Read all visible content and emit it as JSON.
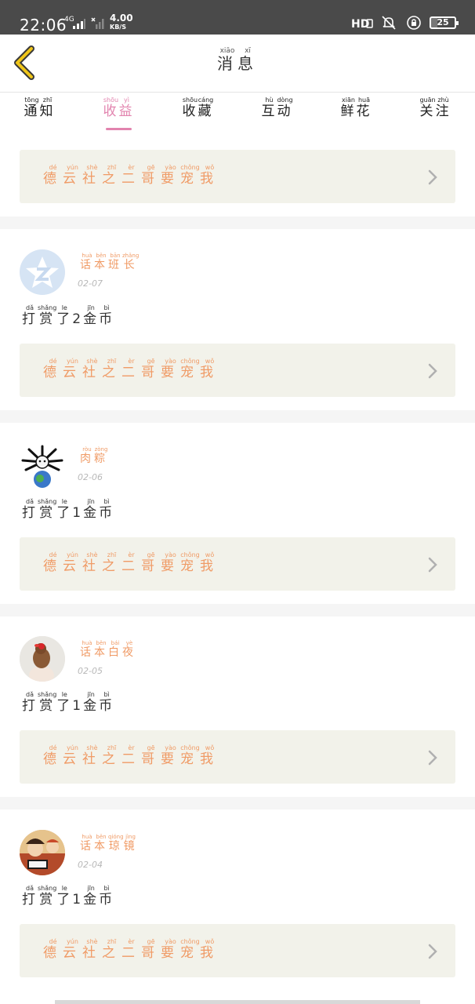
{
  "status_bar": {
    "time": "22:06",
    "network": "4G",
    "speed_value": "4.00",
    "speed_unit": "KB/S",
    "battery": "25",
    "battery_level": 0.25,
    "icons": [
      "signal-icon",
      "hd-icon",
      "mute-icon",
      "lock-icon",
      "battery-icon"
    ]
  },
  "header": {
    "title": [
      "消",
      "息"
    ],
    "title_pinyin": [
      "xiāo",
      "xī"
    ],
    "back_icon": "chevron-left-icon",
    "accent_color": "#f0c619"
  },
  "tabs": [
    {
      "chars": [
        "通",
        "知"
      ],
      "pinyin": [
        "tōng",
        "zhī"
      ],
      "active": false
    },
    {
      "chars": [
        "收",
        "益"
      ],
      "pinyin": [
        "shōu",
        "yì"
      ],
      "active": true
    },
    {
      "chars": [
        "收",
        "藏"
      ],
      "pinyin": [
        "shōu",
        "cáng"
      ],
      "active": false
    },
    {
      "chars": [
        "互",
        "动"
      ],
      "pinyin": [
        "hù",
        "dòng"
      ],
      "active": false
    },
    {
      "chars": [
        "鲜",
        "花"
      ],
      "pinyin": [
        "xiān",
        "huā"
      ],
      "active": false
    },
    {
      "chars": [
        "关",
        "注"
      ],
      "pinyin": [
        "guān",
        "zhù"
      ],
      "active": false
    }
  ],
  "colors": {
    "active_tab": "#e283ae",
    "link_text": "#f09b66",
    "card_bg": "#f2f2ea",
    "date": "#b8b8b8"
  },
  "link_card": {
    "chars": [
      "德",
      "云",
      "社",
      "之",
      "二",
      "哥",
      "要",
      "宠",
      "我"
    ],
    "pinyin": [
      "dé",
      "yún",
      "shè",
      "zhī",
      "èr",
      "gē",
      "yào",
      "chǒng",
      "wǒ"
    ],
    "icon": "chevron-right-icon"
  },
  "entries": [
    {
      "username_chars": [
        "话",
        "本",
        "班",
        "长"
      ],
      "username_pinyin": [
        "huà",
        "běn",
        "bān",
        "zhǎng"
      ],
      "date": "02-07",
      "reward_chars": [
        "打",
        "赏",
        "了",
        "2",
        "金",
        "币"
      ],
      "reward_pinyin": [
        "dǎ",
        "shǎng",
        "le",
        "",
        "jīn",
        "bì"
      ],
      "avatar": "default-avatar-icon"
    },
    {
      "username_chars": [
        "肉",
        "粽"
      ],
      "username_pinyin": [
        "ròu",
        "zòng"
      ],
      "date": "02-06",
      "reward_chars": [
        "打",
        "赏",
        "了",
        "1",
        "金",
        "币"
      ],
      "reward_pinyin": [
        "dǎ",
        "shǎng",
        "le",
        "",
        "jīn",
        "bì"
      ],
      "avatar": "cartoon-avatar-icon"
    },
    {
      "username_chars": [
        "话",
        "本",
        "白",
        "夜"
      ],
      "username_pinyin": [
        "huà",
        "běn",
        "bái",
        "yè"
      ],
      "date": "02-05",
      "reward_chars": [
        "打",
        "赏",
        "了",
        "1",
        "金",
        "币"
      ],
      "reward_pinyin": [
        "dǎ",
        "shǎng",
        "le",
        "",
        "jīn",
        "bì"
      ],
      "avatar": "photo-avatar-icon"
    },
    {
      "username_chars": [
        "话",
        "本",
        "琼",
        "镜"
      ],
      "username_pinyin": [
        "huà",
        "běn",
        "qióng",
        "jìng"
      ],
      "date": "02-04",
      "reward_chars": [
        "打",
        "赏",
        "了",
        "1",
        "金",
        "币"
      ],
      "reward_pinyin": [
        "dǎ",
        "shǎng",
        "le",
        "",
        "jīn",
        "bì"
      ],
      "avatar": "illustration-avatar-icon"
    }
  ]
}
